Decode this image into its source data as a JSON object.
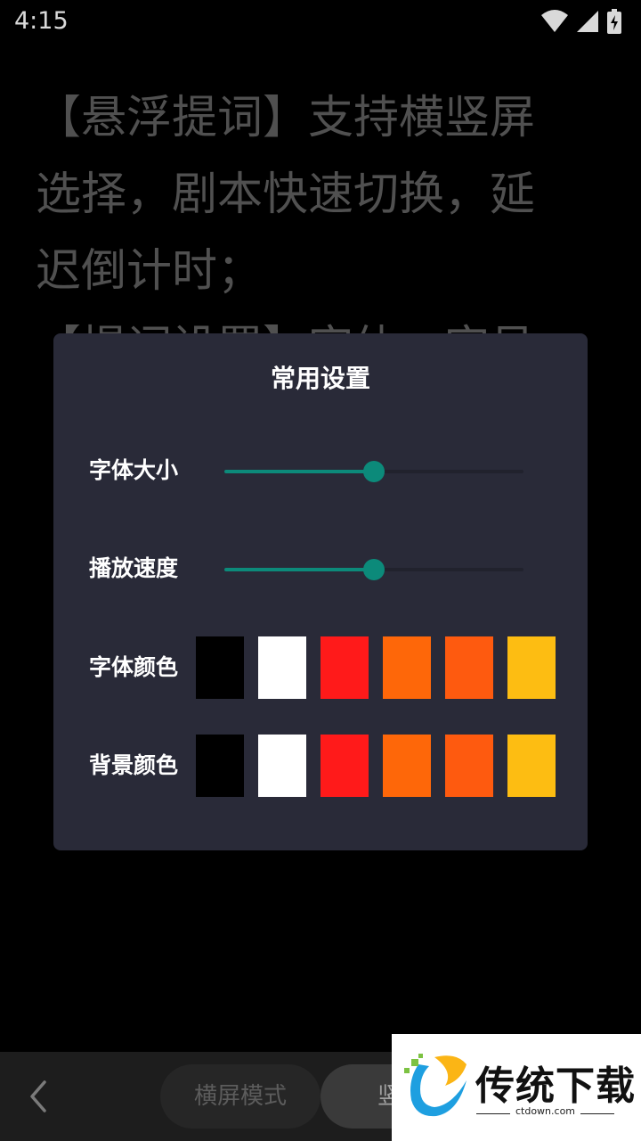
{
  "status_bar": {
    "time": "4:15"
  },
  "script": {
    "lines": [
      "【悬浮提词】支持横竖屏",
      "选择，剧本快速切换，延",
      "迟倒计时；",
      "【提词设置】字体，字号"
    ]
  },
  "dialog": {
    "title": "常用设置",
    "font_size": {
      "label": "字体大小",
      "value": 0.5
    },
    "play_speed": {
      "label": "播放速度",
      "value": 0.5
    },
    "font_color": {
      "label": "字体颜色",
      "options": [
        "#000000",
        "#ffffff",
        "#ff1a1a",
        "#fe6709",
        "#fe5a0f",
        "#fdbd12"
      ]
    },
    "bg_color": {
      "label": "背景颜色",
      "options": [
        "#000000",
        "#ffffff",
        "#ff1a1a",
        "#fe6709",
        "#fe5a0f",
        "#fdbd12"
      ]
    },
    "accent_color": "#0c8a7a"
  },
  "bottom_bar": {
    "landscape_mode": "横屏模式",
    "portrait_mode": "竖屏"
  },
  "watermark": {
    "brand": "传统下载",
    "url": "ctdown.com"
  }
}
